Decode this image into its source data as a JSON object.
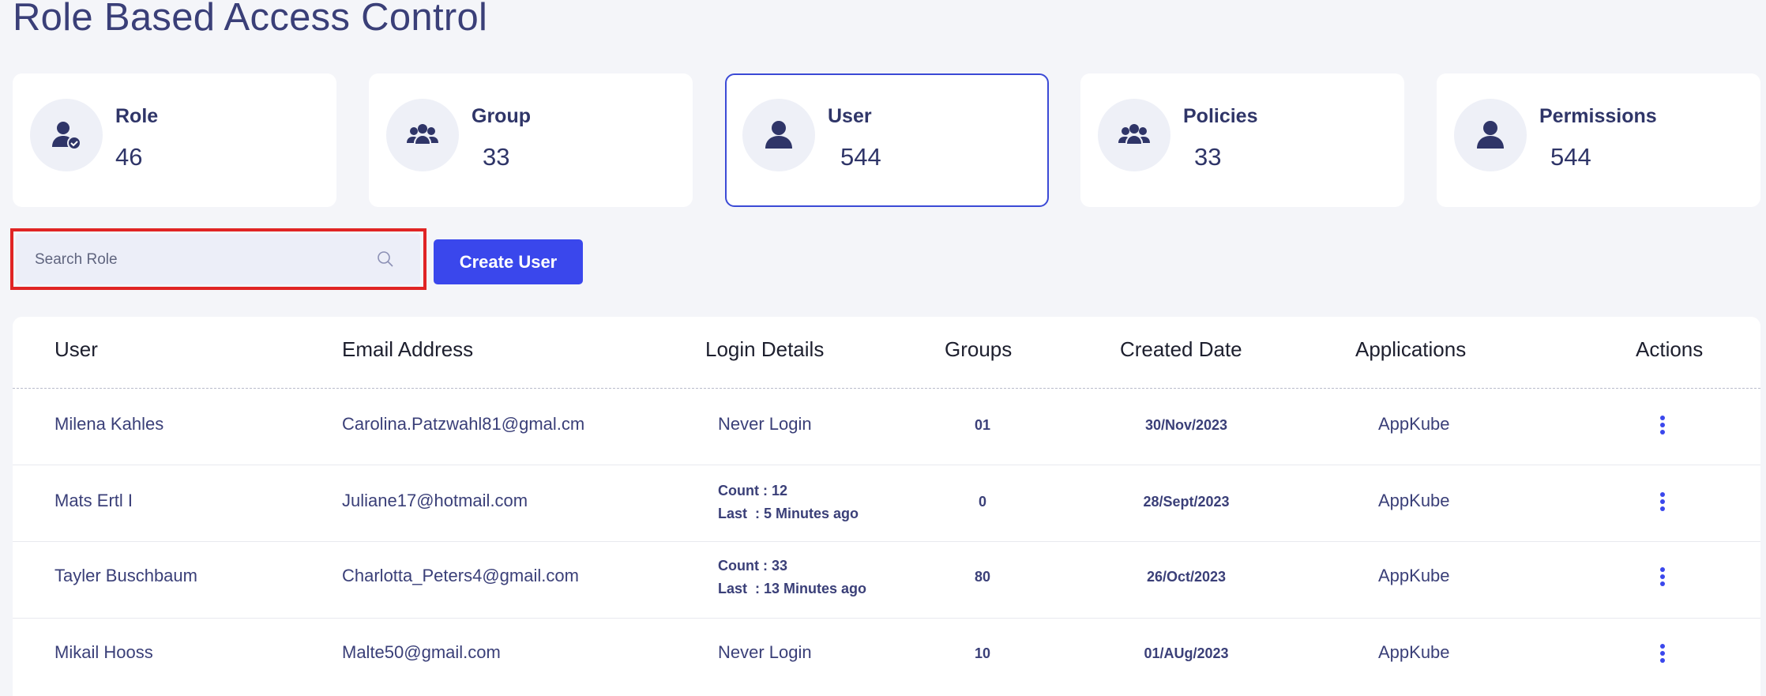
{
  "page": {
    "title": "Role Based Access Control"
  },
  "cards": [
    {
      "label": "Role",
      "value": "46",
      "icon": "user-check-icon",
      "active": false
    },
    {
      "label": "Group",
      "value": "33",
      "icon": "group-icon",
      "active": false
    },
    {
      "label": "User",
      "value": "544",
      "icon": "user-icon",
      "active": true
    },
    {
      "label": "Policies",
      "value": "33",
      "icon": "group-icon",
      "active": false
    },
    {
      "label": "Permissions",
      "value": "544",
      "icon": "user-icon",
      "active": false
    }
  ],
  "search": {
    "placeholder": "Search Role",
    "value": "",
    "icon": "search-icon"
  },
  "toolbar": {
    "create_label": "Create User"
  },
  "table": {
    "headers": {
      "user": "User",
      "email": "Email Address",
      "login": "Login Details",
      "groups": "Groups",
      "created": "Created Date",
      "applications": "Applications",
      "actions": "Actions"
    },
    "rows": [
      {
        "user": "Milena Kahles",
        "email": "Carolina.Patzwahl81@gmal.cm",
        "login": "Never Login",
        "login_count": "",
        "login_last": "",
        "groups": "01",
        "created": "30/Nov/2023",
        "application": "AppKube"
      },
      {
        "user": "Mats Ertl I",
        "email": "Juliane17@hotmail.com",
        "login": "",
        "login_count": "Count : 12",
        "login_last": "Last  : 5 Minutes ago",
        "groups": "0",
        "created": "28/Sept/2023",
        "application": "AppKube"
      },
      {
        "user": "Tayler Buschbaum",
        "email": "Charlotta_Peters4@gmail.com",
        "login": "",
        "login_count": "Count : 33",
        "login_last": "Last  : 13 Minutes ago",
        "groups": "80",
        "created": "26/Oct/2023",
        "application": "AppKube"
      },
      {
        "user": "Mikail Hooss",
        "email": "Malte50@gmail.com",
        "login": "Never Login",
        "login_count": "",
        "login_last": "",
        "groups": "10",
        "created": "01/AUg/2023",
        "application": "AppKube"
      }
    ]
  },
  "colors": {
    "accent": "#3a47ec",
    "active_border": "#3b4ad6",
    "highlight": "#e02424",
    "text": "#2f3568"
  }
}
